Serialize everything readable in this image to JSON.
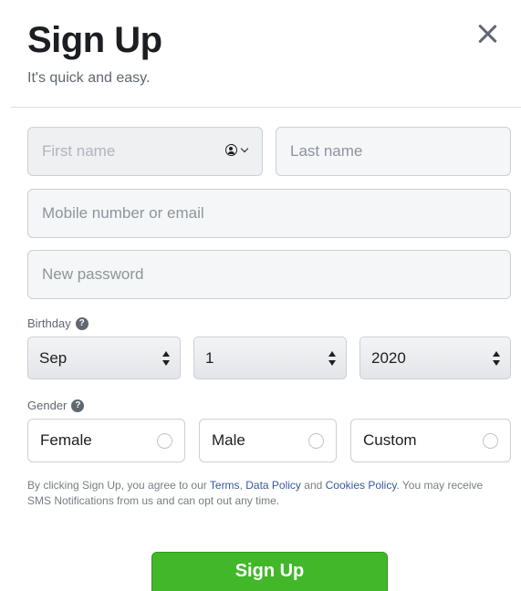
{
  "header": {
    "title": "Sign Up",
    "subtitle": "It's quick and easy."
  },
  "form": {
    "first_name_placeholder": "First name",
    "last_name_placeholder": "Last name",
    "contact_placeholder": "Mobile number or email",
    "password_placeholder": "New password"
  },
  "birthday": {
    "label": "Birthday",
    "month": "Sep",
    "day": "1",
    "year": "2020"
  },
  "gender": {
    "label": "Gender",
    "options": [
      "Female",
      "Male",
      "Custom"
    ]
  },
  "terms": {
    "prefix": "By clicking Sign Up, you agree to our ",
    "terms_link": "Terms",
    "sep1": ", ",
    "data_policy_link": "Data Policy",
    "sep2": " and ",
    "cookies_link": "Cookies Policy",
    "suffix": ". You may receive SMS Notifications from us and can opt out any time."
  },
  "submit_label": "Sign Up"
}
